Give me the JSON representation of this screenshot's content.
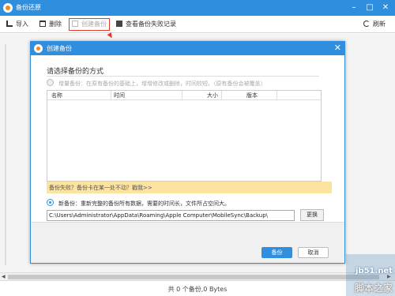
{
  "window": {
    "title": "备份还原"
  },
  "toolbar": {
    "import_label": "导入",
    "delete_label": "删除",
    "create_label": "创建备份",
    "log_label": "查看备份失败记录",
    "refresh_label": "刷新"
  },
  "dialog": {
    "title": "创建备份",
    "heading": "请选择备份的方式",
    "incremental_option": "增量备份：在原有备份的基础上，增增修改或删除，时间较短。（原有备份会被覆盖）",
    "columns": [
      "名称",
      "时间",
      "大小",
      "版本"
    ],
    "warning": "备份失败？备份卡在某一处不动？戳我>>",
    "new_option": "新备份：重新完整的备份所有数据，需要的时间长，文件所占空间大。",
    "path_value": "C:\\Users\\Administrator\\AppData\\Roaming\\Apple Computer\\MobileSync\\Backup\\",
    "browse_label": "更换",
    "ok_label": "备份",
    "cancel_label": "取消"
  },
  "status": {
    "text": "共 0 个备份,0 Bytes"
  },
  "watermark": {
    "domain": "jb51.net",
    "brand": "脚本之家"
  },
  "colors": {
    "accent": "#2f8fde",
    "warning_bg": "#fce39f",
    "highlight_border": "#e23a2d"
  }
}
